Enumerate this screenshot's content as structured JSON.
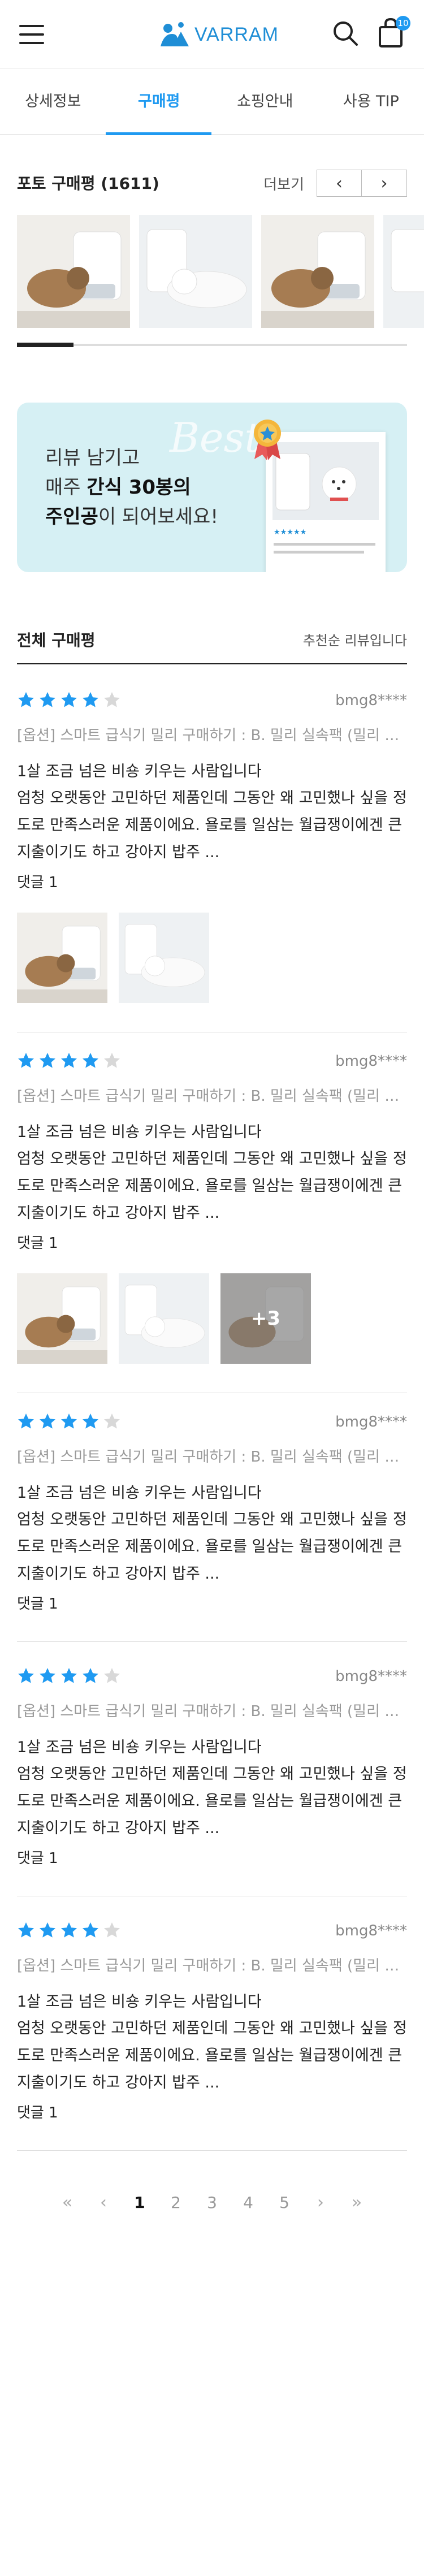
{
  "header": {
    "logo_text": "VARRAM",
    "cart_count": "10",
    "brand_color": "#1f9af1"
  },
  "tabs": [
    {
      "label": "상세정보"
    },
    {
      "label": "구매평"
    },
    {
      "label": "쇼핑안내"
    },
    {
      "label": "사용 TIP"
    }
  ],
  "photo_reviews": {
    "title": "포토 구매평 (1611)",
    "more_label": "더보기",
    "prev_icon": "chevron-left-icon",
    "next_icon": "chevron-right-icon"
  },
  "banner": {
    "line1": "리뷰 남기고",
    "line2_pre": "매주 ",
    "line2_bold": "간식 30봉의",
    "line3_bold": "주인공",
    "line3_post": "이 되어보세요!",
    "ghost_text": "Best"
  },
  "all_reviews": {
    "title": "전체 구매평",
    "sort_label": "추천순 리뷰입니다"
  },
  "reviews": [
    {
      "rating": 4,
      "user": "bmg8****",
      "option": "[옵션] 스마트 급식기 밀리 구매하기 : B. 밀리 실속팩 (밀리 + 코로나 사료통)",
      "title": "1살 조금 넘은 비숑 키우는 사람입니다",
      "body": "엄청 오랫동안 고민하던 제품인데 그동안 왜 고민했나 싶을 정도로 만족스러운 제품이에요. 욜로를 일삼는 월급쟁이에겐 큰 지출이기도 하고 강아지 밥주 ...",
      "comments": "댓글 1",
      "photos": 2
    },
    {
      "rating": 4,
      "user": "bmg8****",
      "option": "[옵션] 스마트 급식기 밀리 구매하기 : B. 밀리 실속팩 (밀리 + 코로나 사료통)",
      "title": "1살 조금 넘은 비숑 키우는 사람입니다",
      "body": "엄청 오랫동안 고민하던 제품인데 그동안 왜 고민했나 싶을 정도로 만족스러운 제품이에요. 욜로를 일삼는 월급쟁이에겐 큰 지출이기도 하고 강아지 밥주 ...",
      "comments": "댓글 1",
      "photos": 3,
      "more_photos": "+3"
    },
    {
      "rating": 4,
      "user": "bmg8****",
      "option": "[옵션] 스마트 급식기 밀리 구매하기 : B. 밀리 실속팩 (밀리 + 코로나 사료통)",
      "title": "1살 조금 넘은 비숑 키우는 사람입니다",
      "body": "엄청 오랫동안 고민하던 제품인데 그동안 왜 고민했나 싶을 정도로 만족스러운 제품이에요. 욜로를 일삼는 월급쟁이에겐 큰 지출이기도 하고 강아지 밥주 ...",
      "comments": "댓글 1",
      "photos": 0
    },
    {
      "rating": 4,
      "user": "bmg8****",
      "option": "[옵션] 스마트 급식기 밀리 구매하기 : B. 밀리 실속팩 (밀리 + 코로나 사료통)",
      "title": "1살 조금 넘은 비숑 키우는 사람입니다",
      "body": "엄청 오랫동안 고민하던 제품인데 그동안 왜 고민했나 싶을 정도로 만족스러운 제품이에요. 욜로를 일삼는 월급쟁이에겐 큰 지출이기도 하고 강아지 밥주 ...",
      "comments": "댓글 1",
      "photos": 0
    },
    {
      "rating": 4,
      "user": "bmg8****",
      "option": "[옵션] 스마트 급식기 밀리 구매하기 : B. 밀리 실속팩 (밀리 + 코로나 사료통)",
      "title": "1살 조금 넘은 비숑 키우는 사람입니다",
      "body": "엄청 오랫동안 고민하던 제품인데 그동안 왜 고민했나 싶을 정도로 만족스러운 제품이에요. 욜로를 일삼는 월급쟁이에겐 큰 지출이기도 하고 강아지 밥주 ...",
      "comments": "댓글 1",
      "photos": 0
    }
  ],
  "pagination": {
    "first_icon": "double-chevron-left-icon",
    "prev_icon": "chevron-left-icon",
    "pages": [
      "1",
      "2",
      "3",
      "4",
      "5"
    ],
    "current": "1",
    "next_icon": "chevron-right-icon",
    "last_icon": "double-chevron-right-icon"
  },
  "colors": {
    "star_filled": "#1f9af1",
    "star_empty": "#d8d8d8"
  }
}
